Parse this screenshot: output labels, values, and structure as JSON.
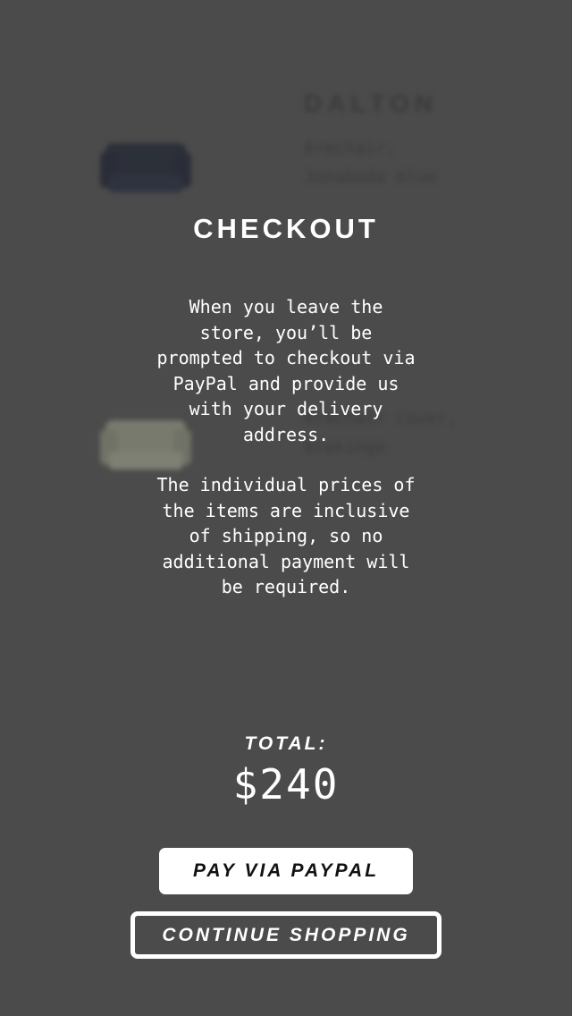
{
  "background_items": [
    {
      "name": "DALTON",
      "desc_line1": "Armchair,",
      "desc_line2": "Jonaboda blue",
      "thumb_icon": "armchair-icon",
      "thumb_color": "#141a2b"
    },
    {
      "name": "",
      "desc_line1": "Armchair cover,",
      "desc_line2": "Blekinge",
      "thumb_icon": "armchair-icon",
      "thumb_color": "#9ea28c"
    }
  ],
  "checkout": {
    "title": "CHECKOUT",
    "paragraph_1": "When you leave the store, you’ll be prompted to checkout via PayPal and provide us with your delivery address.",
    "paragraph_2": "The individual prices of the items are inclusive of shipping, so no additional payment will be required.",
    "total_label": "TOTAL:",
    "total_value": "$240",
    "pay_button": "PAY VIA PAYPAL",
    "continue_button": "CONTINUE SHOPPING"
  },
  "colors": {
    "overlay_bg": "#4b4b4b",
    "text": "#ffffff",
    "button_bg": "#ffffff",
    "button_text": "#111111"
  }
}
